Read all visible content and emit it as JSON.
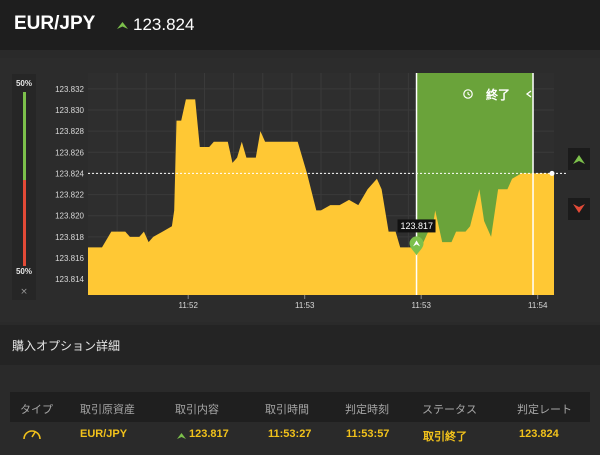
{
  "header": {
    "pair": "EUR/JPY",
    "rate": "123.824",
    "direction_icon": "arrow-up-icon",
    "up_color": "#7cc04b"
  },
  "chart": {
    "gauge": {
      "top_label": "50%",
      "bottom_label": "50%",
      "close": "×"
    },
    "entry_label": "123.817",
    "end_label": "終了",
    "end_icon": "clock-icon",
    "buttons": {
      "high": "arrow-up-icon",
      "low": "arrow-down-icon"
    }
  },
  "chart_data": {
    "type": "area",
    "y_ticks": [
      "123.814",
      "123.816",
      "123.818",
      "123.820",
      "123.822",
      "123.824",
      "123.826",
      "123.828",
      "123.830",
      "123.832"
    ],
    "x_ticks": [
      "11:52",
      "11:53",
      "11:53",
      "11:54"
    ],
    "ylim": [
      123.8125,
      123.8335
    ],
    "current_rate": 123.824,
    "series": [
      {
        "values": [
          [
            0,
            123.817
          ],
          [
            0.03,
            123.817
          ],
          [
            0.05,
            123.8185
          ],
          [
            0.08,
            123.8185
          ],
          [
            0.09,
            123.818
          ],
          [
            0.11,
            123.818
          ],
          [
            0.12,
            123.8185
          ],
          [
            0.13,
            123.8175
          ],
          [
            0.14,
            123.818
          ],
          [
            0.16,
            123.8185
          ],
          [
            0.18,
            123.819
          ],
          [
            0.185,
            123.8205
          ],
          [
            0.19,
            123.829
          ],
          [
            0.2,
            123.829
          ],
          [
            0.21,
            123.831
          ],
          [
            0.23,
            123.831
          ],
          [
            0.24,
            123.8265
          ],
          [
            0.26,
            123.8265
          ],
          [
            0.27,
            123.827
          ],
          [
            0.3,
            123.827
          ],
          [
            0.31,
            123.825
          ],
          [
            0.32,
            123.8255
          ],
          [
            0.33,
            123.827
          ],
          [
            0.34,
            123.8255
          ],
          [
            0.36,
            123.8255
          ],
          [
            0.37,
            123.828
          ],
          [
            0.38,
            123.827
          ],
          [
            0.45,
            123.827
          ],
          [
            0.47,
            123.824
          ],
          [
            0.49,
            123.8205
          ],
          [
            0.5,
            123.8205
          ],
          [
            0.52,
            123.821
          ],
          [
            0.54,
            123.821
          ],
          [
            0.56,
            123.8215
          ],
          [
            0.58,
            123.821
          ],
          [
            0.6,
            123.8225
          ],
          [
            0.62,
            123.8235
          ],
          [
            0.63,
            123.8225
          ],
          [
            0.645,
            123.8185
          ],
          [
            0.66,
            123.8185
          ],
          [
            0.67,
            123.817
          ],
          [
            0.705,
            123.817
          ],
          [
            0.72,
            123.8175
          ],
          [
            0.73,
            123.8185
          ],
          [
            0.74,
            123.819
          ],
          [
            0.745,
            123.8205
          ],
          [
            0.76,
            123.8175
          ],
          [
            0.78,
            123.8175
          ],
          [
            0.79,
            123.8185
          ],
          [
            0.81,
            123.8185
          ],
          [
            0.82,
            123.819
          ],
          [
            0.84,
            123.8225
          ],
          [
            0.85,
            123.8195
          ],
          [
            0.865,
            123.818
          ],
          [
            0.88,
            123.8225
          ],
          [
            0.9,
            123.8225
          ],
          [
            0.91,
            123.8235
          ],
          [
            0.93,
            123.824
          ],
          [
            1.0,
            123.824
          ]
        ]
      }
    ],
    "entry_rate": 123.817,
    "colors": {
      "area": "#ffc834",
      "window": "#6aa33a",
      "up": "#7cc04b",
      "down": "#e24a37"
    }
  },
  "details": {
    "title": "購入オプション詳細",
    "columns": [
      "タイプ",
      "取引原資産",
      "取引内容",
      "取引時間",
      "判定時刻",
      "ステータス",
      "判定レート"
    ],
    "row": {
      "type_icon": "gauge-icon",
      "asset": "EUR/JPY",
      "direction_icon": "arrow-up-icon",
      "content": "123.817",
      "trade_time": "11:53:27",
      "judge_time": "11:53:57",
      "status": "取引終了",
      "judge_rate": "123.824"
    },
    "accent_color": "#f2c21b"
  }
}
